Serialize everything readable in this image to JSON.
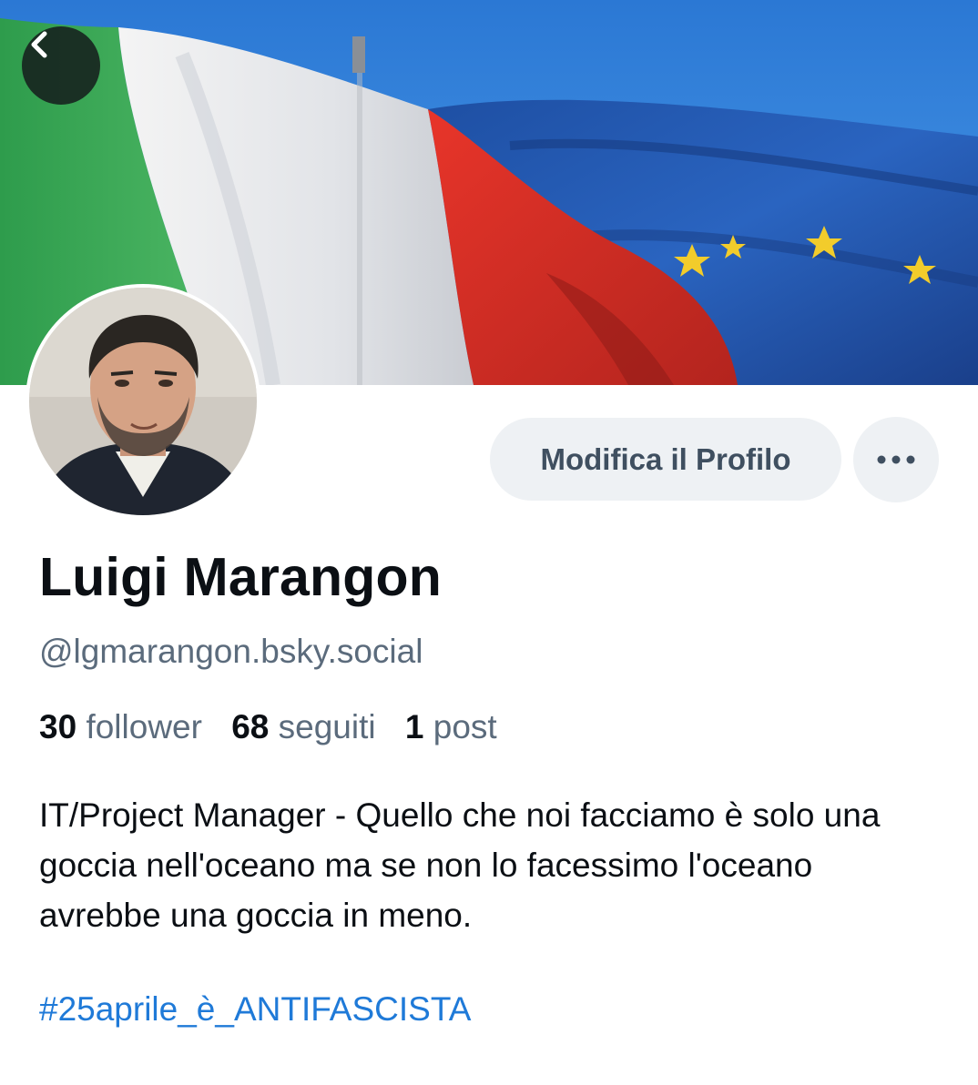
{
  "profile": {
    "display_name": "Luigi Marangon",
    "handle": "@lgmarangon.bsky.social",
    "stats": {
      "followers_count": "30",
      "followers_label": "follower",
      "following_count": "68",
      "following_label": "seguiti",
      "posts_count": "1",
      "posts_label": "post"
    },
    "bio": "IT/Project Manager - Quello che noi facciamo è solo una goccia nell'oceano ma se non lo facessimo l'oceano avrebbe una goccia in meno.",
    "hashtag": "#25aprile_è_ANTIFASCISTA"
  },
  "actions": {
    "edit_profile_label": "Modifica il Profilo"
  },
  "icons": {
    "back": "chevron-left-icon",
    "more": "more-horizontal-icon"
  },
  "colors": {
    "link": "#1f7ad8",
    "secondary_text": "#5b6b7c",
    "button_bg": "#eef1f4"
  }
}
